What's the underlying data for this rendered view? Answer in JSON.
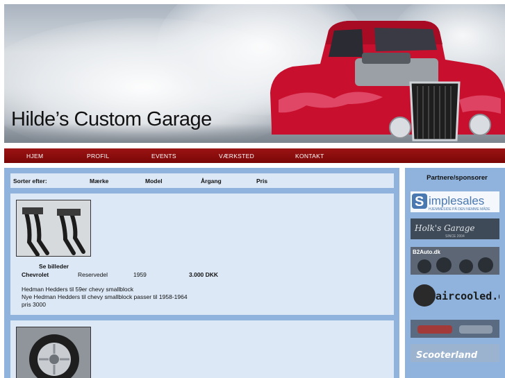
{
  "site": {
    "title": "Hilde’s Custom Garage"
  },
  "nav": {
    "items": [
      {
        "label": "HJEM"
      },
      {
        "label": "PROFIL"
      },
      {
        "label": "EVENTS"
      },
      {
        "label": "VÆRKSTED"
      },
      {
        "label": "KONTAKT"
      }
    ]
  },
  "sort": {
    "label": "Sorter efter:",
    "options": [
      "Mærke",
      "Model",
      "Årgang",
      "Pris"
    ]
  },
  "listings": [
    {
      "see_images": "Se billeder",
      "brand": "Chevrolet",
      "model": "Reservedel",
      "year": "1959",
      "price": "3.000 DKK",
      "description": [
        "Hedman Hedders til 59er chevy smallblock",
        "Nye Hedman Hedders til chevy smallblock passer til 1958-1964",
        "pris 3000"
      ]
    },
    {
      "see_images": "",
      "brand": "",
      "model": "",
      "year": "",
      "price": "",
      "description": []
    }
  ],
  "sidebar": {
    "title": "Partnere/sponsorer",
    "sponsors": [
      {
        "name": "simplesales",
        "text": "implesales",
        "tagline": "HJEMMESIDE PÅ DEN NEMME MÅDE"
      },
      {
        "name": "holks-garage",
        "text": "Holk's Garage",
        "tagline": "SINCE 2004"
      },
      {
        "name": "b2auto",
        "text": "B2Auto.dk"
      },
      {
        "name": "aircooled",
        "text": "aircooled.dk"
      },
      {
        "name": "banner-5",
        "text": ""
      },
      {
        "name": "scooterland",
        "text": "Scooterland"
      }
    ]
  }
}
